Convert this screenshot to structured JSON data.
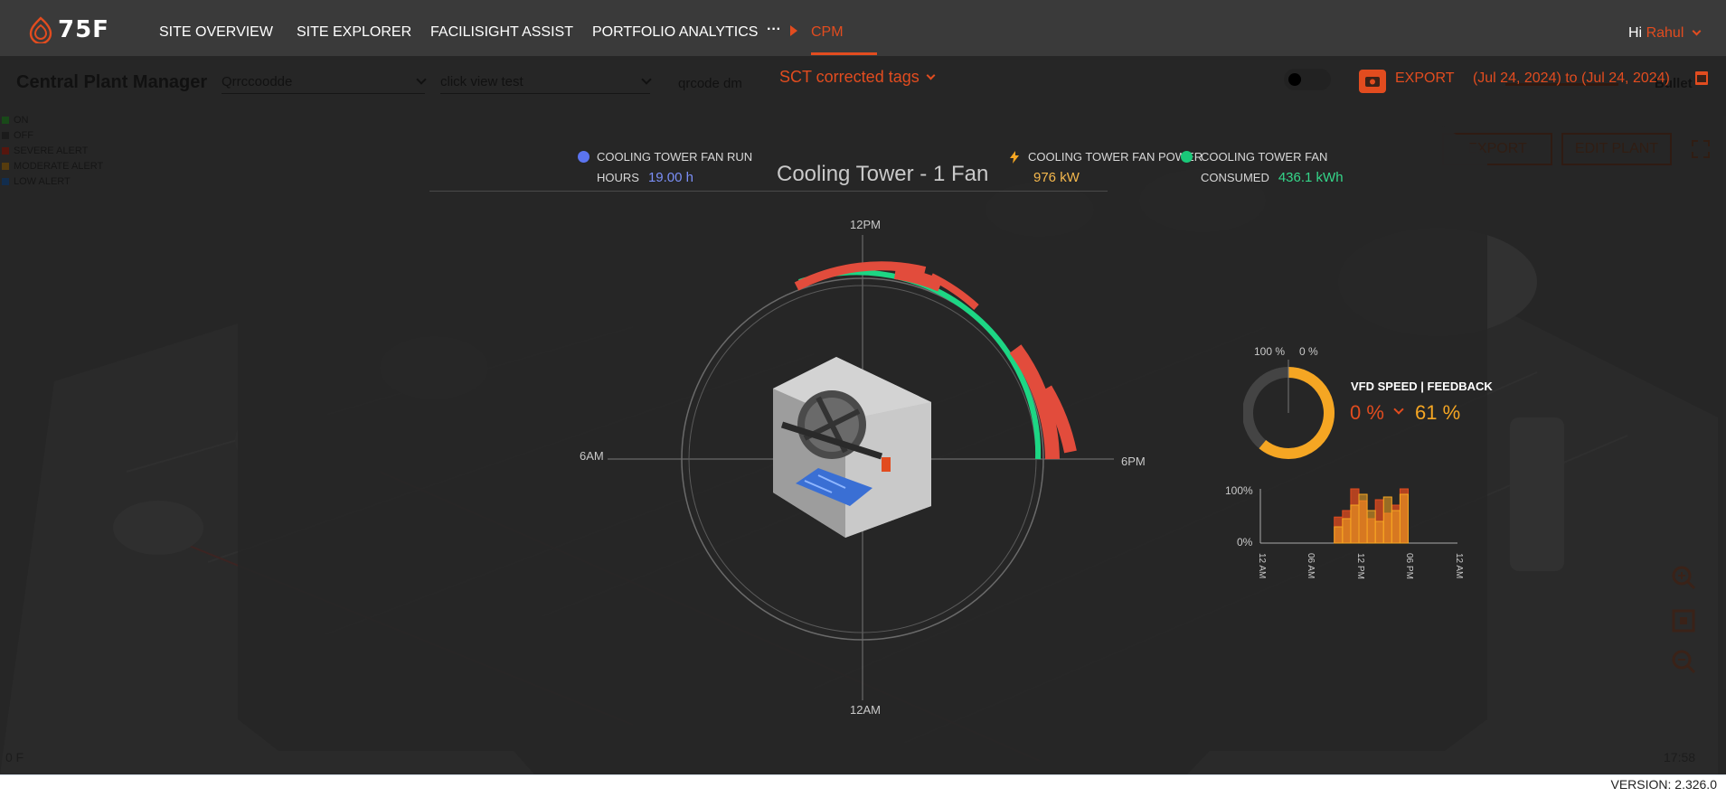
{
  "nav": {
    "brand": "75F",
    "items": [
      "SITE OVERVIEW",
      "SITE EXPLORER",
      "FACILISIGHT ASSIST",
      "PORTFOLIO ANALYTICS"
    ],
    "more": "···",
    "active": "CPM",
    "greeting": "Hi",
    "user": "Rahul"
  },
  "background": {
    "title": "Central Plant Manager",
    "select1": "Qrrccoodde",
    "select2": "click view test",
    "text1": "qrcode dm",
    "tab_label": "Bullet",
    "legend": [
      {
        "label": "ON",
        "color": "#1f5a1f"
      },
      {
        "label": "OFF",
        "color": "#2b2b2b"
      },
      {
        "label": "SEVERE ALERT",
        "color": "#6a1c12"
      },
      {
        "label": "MODERATE ALERT",
        "color": "#6a4a12"
      },
      {
        "label": "LOW ALERT",
        "color": "#17385e"
      }
    ],
    "export_btn": "EXPORT",
    "edit_btn": "EDIT PLANT",
    "footer_left": "0 F",
    "footer_right": "17:58",
    "colors": {
      "accent": "#e24c1f"
    }
  },
  "modal": {
    "tags_dropdown": "SCT corrected tags",
    "export_label": "EXPORT",
    "date_range": "(Jul 24, 2024) to (Jul 24, 2024)",
    "title": "Cooling Tower - 1 Fan",
    "stats": {
      "run_label_1": "COOLING TOWER FAN RUN",
      "run_label_2": "HOURS",
      "run_value": "19.00 h",
      "power_label": "COOLING TOWER FAN POWER",
      "power_value": "976 kW",
      "consumed_label_1": "COOLING TOWER FAN",
      "consumed_label_2": "CONSUMED",
      "consumed_value": "436.1 kWh"
    },
    "clock": {
      "top": "12PM",
      "bottom": "12AM",
      "left": "6AM",
      "right": "6PM"
    },
    "vfd": {
      "title": "VFD SPEED | FEEDBACK",
      "speed": "0 %",
      "feedback": "61 %",
      "gauge_left": "100 %",
      "gauge_right": "0 %",
      "feedback_fraction": 0.61
    }
  },
  "chart_data": {
    "type": "bar",
    "x_ticks": [
      "12 AM",
      "06 AM",
      "12 PM",
      "06 PM",
      "12 AM"
    ],
    "y_ticks": [
      "100%",
      "0%"
    ],
    "ylim": [
      0,
      100
    ],
    "hours": [
      9.5,
      10.5,
      11.5,
      12.5,
      13.5,
      14.5,
      15.5,
      16.5,
      17.5
    ],
    "series": [
      {
        "color": "#e24c1f",
        "values": [
          48,
          60,
          100,
          78,
          45,
          80,
          55,
          70,
          100
        ]
      },
      {
        "color": "#f5a623",
        "values": [
          30,
          45,
          70,
          90,
          60,
          40,
          85,
          60,
          90
        ]
      }
    ]
  },
  "version": "VERSION: 2.326.0"
}
